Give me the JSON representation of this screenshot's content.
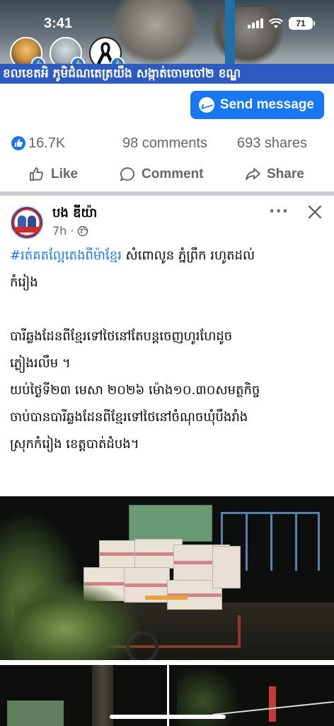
{
  "status_bar": {
    "time": "3:41",
    "battery": "71"
  },
  "prev_post": {
    "caption": "ខលខេតអិ ភូមិជំណតេត្រយឹង សង្កាត់ចោមចៅ២ ខណ្ឌ",
    "send_message_label": "Send message",
    "likes": "16.7K",
    "comments": "98 comments",
    "shares": "693 shares",
    "actions": {
      "like": "Like",
      "comment": "Comment",
      "share": "Share"
    }
  },
  "post": {
    "page_name": "បង ឌីយ៉ា",
    "time": "7h ·",
    "hashtag": "#រត់គតល្អែតេងពីម៉ាខ្មែរ",
    "line1_rest": " សំពោលូន ភ្នំព្រឹក រហូតដល់",
    "line2": "កំរៀង",
    "para2_line1": "បារីឆ្លងដែនពីខ្មែរទៅថៃនៅតែបន្តចេញហូរហែដូច",
    "para2_line2": "ភ្លៀងរលឹម ។",
    "para3_line1": "យប់ថ្ងៃទី២៣ មេសា ២០២៦ ម៉ោង១០.៣០សមត្ថកិច្ច",
    "para3_line2": "ចាប់បានបារីឆ្លងដែនពីខ្មែរទៅថៃនៅចំណុចឃុំបឹងរាំង",
    "para3_line3": "ស្រុកកំរៀង ខេត្តបាត់ដំបង។"
  },
  "colors": {
    "brand_blue": "#1877f2",
    "text": "#050505",
    "muted": "#65676b"
  }
}
